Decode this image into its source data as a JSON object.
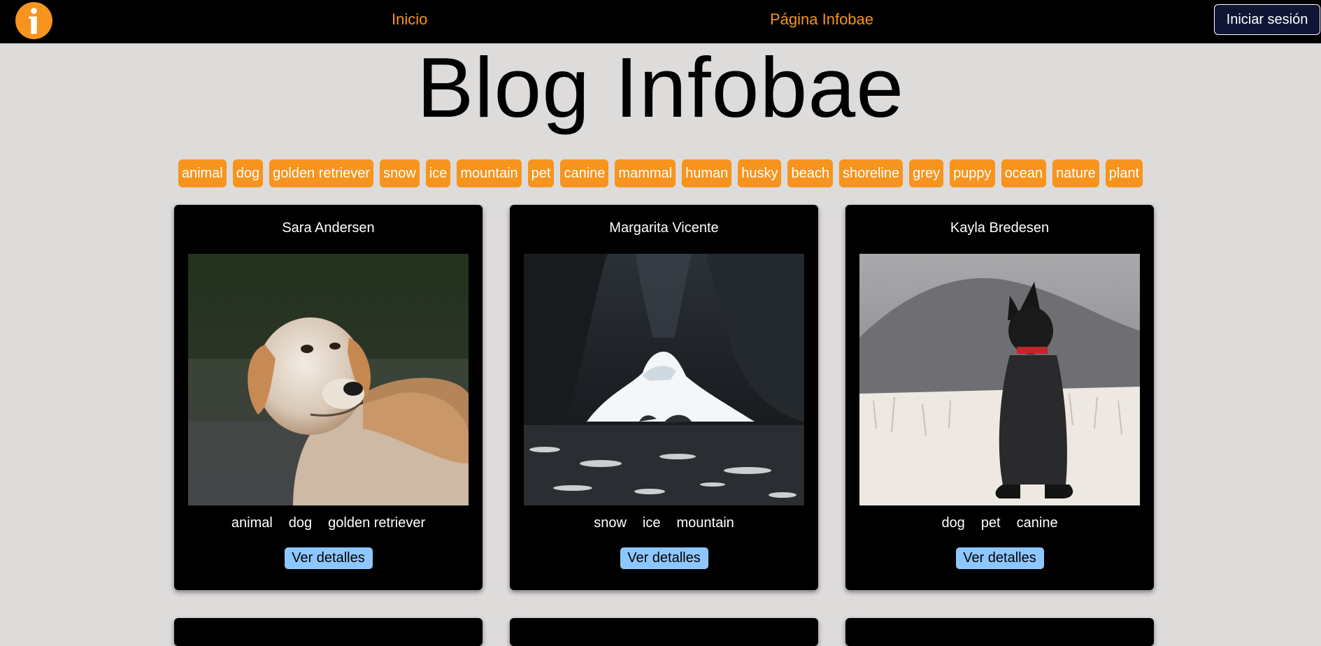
{
  "navbar": {
    "logo_icon": "infobae-info-logo-icon",
    "links": [
      {
        "label": "Inicio"
      },
      {
        "label": "Página Infobae"
      }
    ],
    "login_label": "Iniciar sesión"
  },
  "colors": {
    "accent": "#f7941d",
    "navbar_bg": "#000000",
    "page_bg": "#dedbdb",
    "login_bg": "#0f1535",
    "details_button": "#8ec7ff"
  },
  "page_title": "Blog Infobae",
  "tags": [
    "animal",
    "dog",
    "golden retriever",
    "snow",
    "ice",
    "mountain",
    "pet",
    "canine",
    "mammal",
    "human",
    "husky",
    "beach",
    "shoreline",
    "grey",
    "puppy",
    "ocean",
    "nature",
    "plant"
  ],
  "posts": [
    {
      "author": "Sara Andersen",
      "image": "golden-retriever-photo",
      "tags": [
        "animal",
        "dog",
        "golden retriever"
      ],
      "button_label": "Ver detalles"
    },
    {
      "author": "Margarita Vicente",
      "image": "ice-cave-mountain-photo",
      "tags": [
        "snow",
        "ice",
        "mountain"
      ],
      "button_label": "Ver detalles"
    },
    {
      "author": "Kayla Bredesen",
      "image": "black-dog-in-snow-photo",
      "tags": [
        "dog",
        "pet",
        "canine"
      ],
      "button_label": "Ver detalles"
    }
  ]
}
